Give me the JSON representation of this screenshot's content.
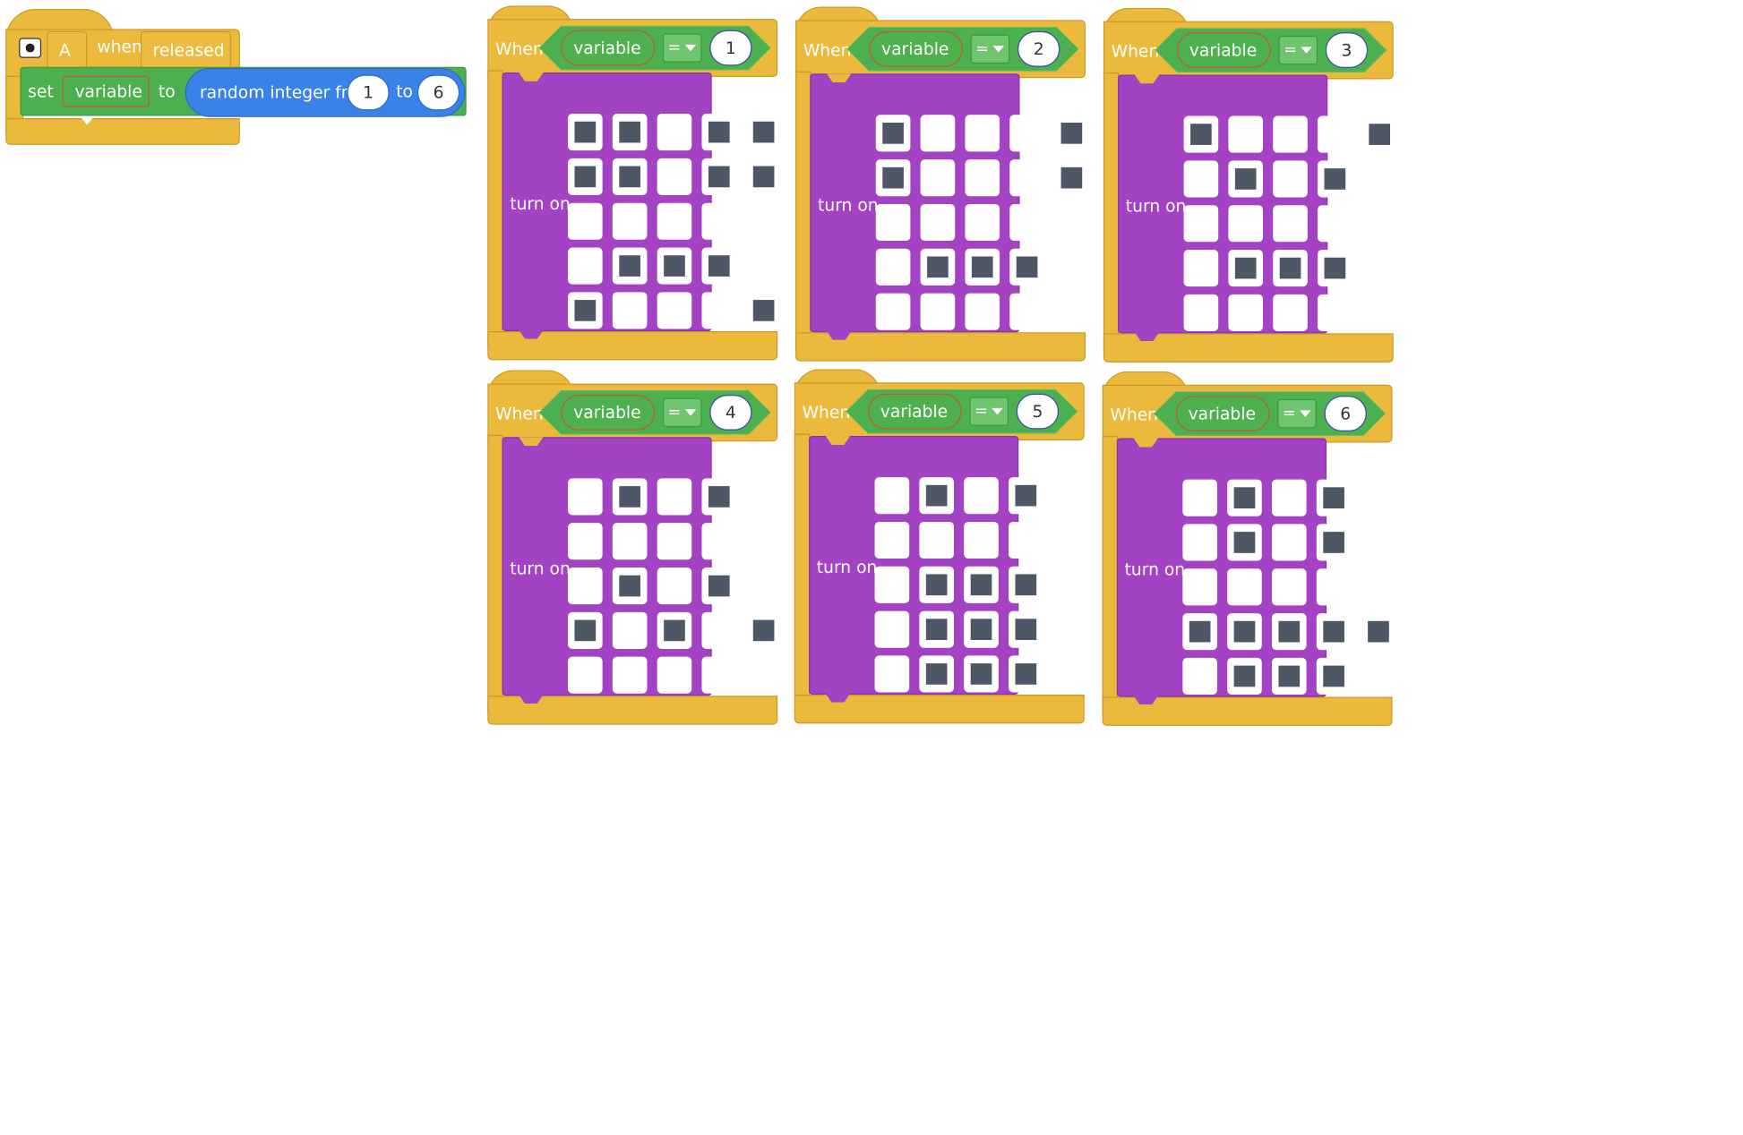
{
  "main_block": {
    "button_value": "A",
    "when_label": "when",
    "event_value": "released",
    "set_label": "set",
    "variable_value": "variable",
    "to_label": "to",
    "random_label": "random integer from",
    "from_value": "1",
    "to_label2": "to",
    "to_value": "6"
  },
  "cases": [
    {
      "when": "When",
      "var": "variable",
      "op": "=",
      "value": "1",
      "turn_on": "turn on",
      "grid": [
        [
          1,
          1,
          0,
          1,
          1
        ],
        [
          1,
          1,
          0,
          1,
          1
        ],
        [
          0,
          0,
          0,
          0,
          0
        ],
        [
          0,
          1,
          1,
          1,
          0
        ],
        [
          1,
          0,
          0,
          0,
          1
        ]
      ]
    },
    {
      "when": "When",
      "var": "variable",
      "op": "=",
      "value": "2",
      "turn_on": "turn on",
      "grid": [
        [
          1,
          0,
          0,
          0,
          1
        ],
        [
          1,
          0,
          0,
          0,
          1
        ],
        [
          0,
          0,
          0,
          0,
          0
        ],
        [
          0,
          1,
          1,
          1,
          0
        ],
        [
          0,
          0,
          0,
          0,
          0
        ]
      ]
    },
    {
      "when": "When",
      "var": "variable",
      "op": "=",
      "value": "3",
      "turn_on": "turn on",
      "grid": [
        [
          1,
          0,
          0,
          0,
          1
        ],
        [
          0,
          1,
          0,
          1,
          0
        ],
        [
          0,
          0,
          0,
          0,
          0
        ],
        [
          0,
          1,
          1,
          1,
          0
        ],
        [
          0,
          0,
          0,
          0,
          0
        ]
      ]
    },
    {
      "when": "When",
      "var": "variable",
      "op": "=",
      "value": "4",
      "turn_on": "turn on",
      "grid": [
        [
          0,
          1,
          0,
          1,
          0
        ],
        [
          0,
          0,
          0,
          0,
          0
        ],
        [
          0,
          1,
          0,
          1,
          0
        ],
        [
          1,
          0,
          1,
          0,
          1
        ],
        [
          0,
          0,
          0,
          0,
          0
        ]
      ]
    },
    {
      "when": "When",
      "var": "variable",
      "op": "=",
      "value": "5",
      "turn_on": "turn on",
      "grid": [
        [
          0,
          1,
          0,
          1,
          0
        ],
        [
          0,
          0,
          0,
          0,
          0
        ],
        [
          0,
          1,
          1,
          1,
          0
        ],
        [
          0,
          1,
          1,
          1,
          0
        ],
        [
          0,
          1,
          1,
          1,
          0
        ]
      ]
    },
    {
      "when": "When",
      "var": "variable",
      "op": "=",
      "value": "6",
      "turn_on": "turn on",
      "grid": [
        [
          0,
          1,
          0,
          1,
          0
        ],
        [
          0,
          1,
          0,
          1,
          0
        ],
        [
          0,
          0,
          0,
          0,
          0
        ],
        [
          1,
          1,
          1,
          1,
          1
        ],
        [
          0,
          1,
          1,
          1,
          0
        ]
      ]
    }
  ]
}
